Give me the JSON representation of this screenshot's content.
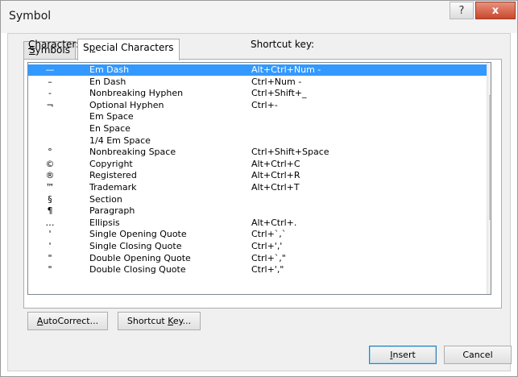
{
  "window": {
    "title": "Symbol",
    "help_label": "?",
    "close_label": "x"
  },
  "tabs": [
    {
      "pre": "",
      "u": "S",
      "post": "ymbols"
    },
    {
      "pre": "S",
      "u": "p",
      "post": "ecial Characters"
    }
  ],
  "headers": {
    "char_u": "C",
    "char_rest": "haracter:",
    "key": "Shortcut key:"
  },
  "rows": [
    {
      "glyph": "—",
      "name": "Em Dash",
      "key": "Alt+Ctrl+Num -"
    },
    {
      "glyph": "–",
      "name": "En Dash",
      "key": "Ctrl+Num -"
    },
    {
      "glyph": "-",
      "name": "Nonbreaking Hyphen",
      "key": "Ctrl+Shift+_"
    },
    {
      "glyph": "¬",
      "name": "Optional Hyphen",
      "key": "Ctrl+-"
    },
    {
      "glyph": "",
      "name": "Em Space",
      "key": ""
    },
    {
      "glyph": "",
      "name": "En Space",
      "key": ""
    },
    {
      "glyph": "",
      "name": "1/4 Em Space",
      "key": ""
    },
    {
      "glyph": "°",
      "name": "Nonbreaking Space",
      "key": "Ctrl+Shift+Space"
    },
    {
      "glyph": "©",
      "name": "Copyright",
      "key": "Alt+Ctrl+C"
    },
    {
      "glyph": "®",
      "name": "Registered",
      "key": "Alt+Ctrl+R"
    },
    {
      "glyph": "™",
      "name": "Trademark",
      "key": "Alt+Ctrl+T"
    },
    {
      "glyph": "§",
      "name": "Section",
      "key": ""
    },
    {
      "glyph": "¶",
      "name": "Paragraph",
      "key": ""
    },
    {
      "glyph": "…",
      "name": "Ellipsis",
      "key": "Alt+Ctrl+."
    },
    {
      "glyph": "'",
      "name": "Single Opening Quote",
      "key": "Ctrl+`,`"
    },
    {
      "glyph": "'",
      "name": "Single Closing Quote",
      "key": "Ctrl+','"
    },
    {
      "glyph": "\"",
      "name": "Double Opening Quote",
      "key": "Ctrl+`,\""
    },
    {
      "glyph": "\"",
      "name": "Double Closing Quote",
      "key": "Ctrl+',\""
    }
  ],
  "selected_index": 0,
  "buttons": {
    "autocorrect": {
      "u": "A",
      "post": "utoCorrect..."
    },
    "shortcut": {
      "pre": "Shortcut ",
      "u": "K",
      "post": "ey..."
    },
    "insert": {
      "u": "I",
      "post": "nsert"
    },
    "cancel": "Cancel"
  },
  "scrollbar": {
    "up_icon": "triangle-up",
    "down_icon": "triangle-down",
    "grip_icon": "grip-lines"
  },
  "colors": {
    "selection": "#3399ff",
    "close": "#c9482c"
  }
}
